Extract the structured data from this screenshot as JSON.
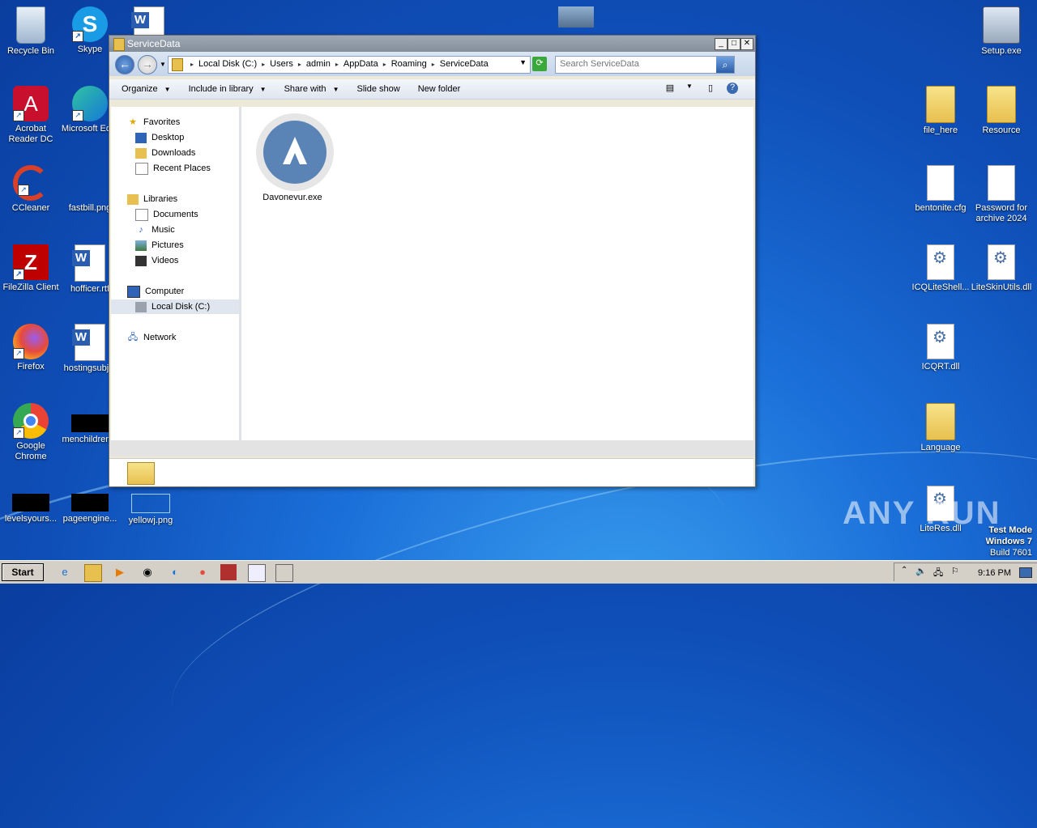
{
  "desktop": {
    "left_icons": [
      {
        "label": "Recycle Bin"
      },
      {
        "label": "Skype"
      },
      {
        "label": "Acrobat Reader DC"
      },
      {
        "label": "Microsoft Ed..."
      },
      {
        "label": "CCleaner"
      },
      {
        "label": "fastbill.png"
      },
      {
        "label": "FileZilla Client"
      },
      {
        "label": "hofficer.rtf"
      },
      {
        "label": "Firefox"
      },
      {
        "label": "hostingsubj..."
      },
      {
        "label": "Google Chrome"
      },
      {
        "label": "menchildren..."
      },
      {
        "label": "levelsyours..."
      },
      {
        "label": "pageengine..."
      },
      {
        "label": "yellowj.png"
      }
    ],
    "right_icons": [
      {
        "label": "Setup.exe"
      },
      {
        "label": "file_here"
      },
      {
        "label": "Resource"
      },
      {
        "label": "bentonite.cfg"
      },
      {
        "label": "Password for archive 2024"
      },
      {
        "label": "ICQLiteShell..."
      },
      {
        "label": "LiteSkinUtils.dll"
      },
      {
        "label": "ICQRT.dll"
      },
      {
        "label": "Language"
      },
      {
        "label": "LiteRes.dll"
      }
    ]
  },
  "window": {
    "title": "ServiceData",
    "address": {
      "crumbs": [
        "Local Disk (C:)",
        "Users",
        "admin",
        "AppData",
        "Roaming",
        "ServiceData"
      ]
    },
    "search": {
      "placeholder": "Search ServiceData"
    },
    "commands": {
      "organize": "Organize",
      "include_in_library": "Include in library",
      "share_with": "Share with",
      "slide_show": "Slide show",
      "new_folder": "New folder"
    },
    "nav": {
      "favorites": "Favorites",
      "desktop": "Desktop",
      "downloads": "Downloads",
      "recent_places": "Recent Places",
      "libraries": "Libraries",
      "documents": "Documents",
      "music": "Music",
      "pictures": "Pictures",
      "videos": "Videos",
      "computer": "Computer",
      "local_disk": "Local Disk (C:)",
      "network": "Network"
    },
    "files": [
      {
        "name": "Davonevur.exe"
      }
    ]
  },
  "taskbar": {
    "start": "Start",
    "clock": "9:16 PM"
  },
  "watermark": "ANY RUN",
  "test_mode": {
    "line1": "Test Mode",
    "line2": "Windows 7",
    "line3": "Build 7601"
  }
}
